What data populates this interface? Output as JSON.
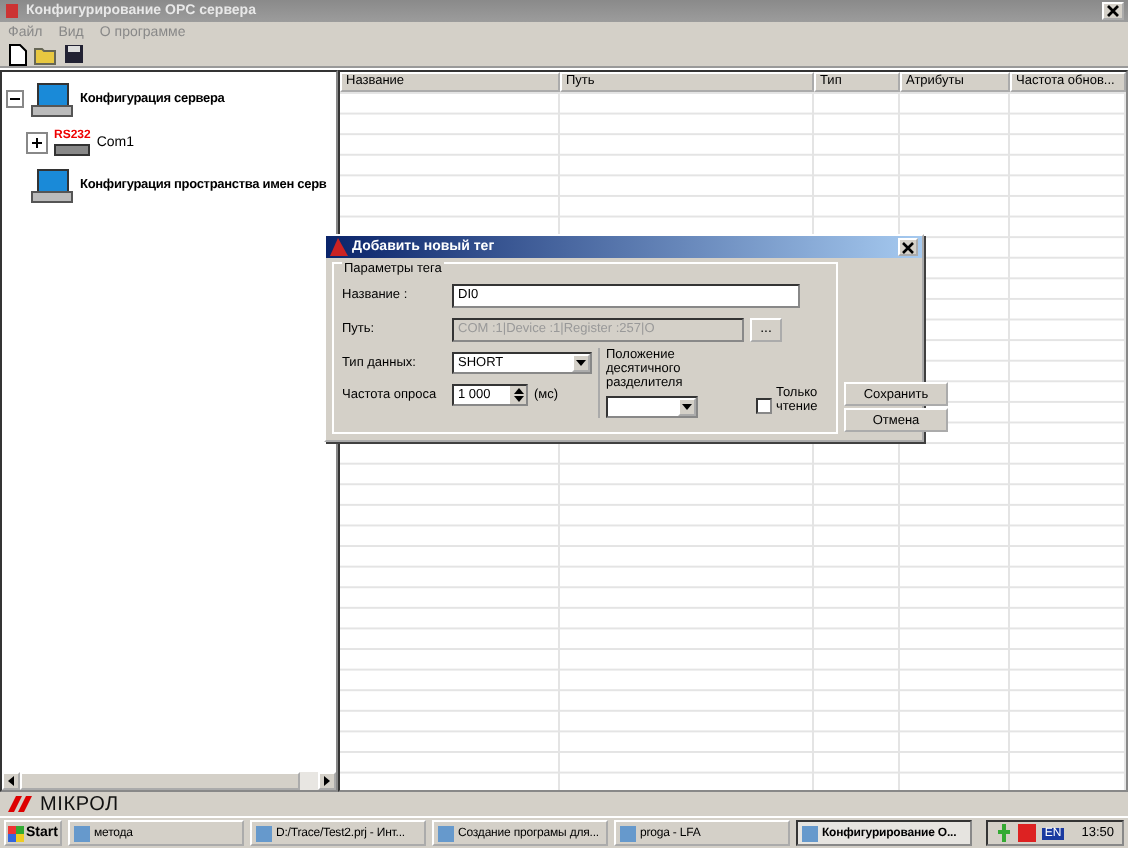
{
  "window": {
    "title": "Конфигурирование OPC сервера"
  },
  "menu": [
    {
      "label": "Файл"
    },
    {
      "label": "Вид"
    },
    {
      "label": "О программе"
    }
  ],
  "tree": [
    {
      "label": "Конфигурация сервера",
      "expanded": true,
      "children": [
        {
          "badge": "RS232",
          "label": "Com1",
          "expanded": false
        }
      ]
    },
    {
      "label": "Конфигурация пространства имен серв"
    }
  ],
  "table": {
    "columns": [
      "Название",
      "Путь",
      "Тип",
      "Атрибуты",
      "Частота обнов..."
    ]
  },
  "dialog": {
    "title": "Добавить новый тег",
    "group_label": "Параметры тега",
    "name": {
      "label": "Название :",
      "value": "DI0"
    },
    "path": {
      "label": "Путь:",
      "value": "COM :1|Device :1|Register :257|O",
      "disabled": true,
      "browse": "..."
    },
    "type": {
      "label": "Тип данных:",
      "value": "SHORT"
    },
    "frequency": {
      "label": "Частота опроса",
      "value": "1 000",
      "unit": "(мс)"
    },
    "decimal": {
      "label": "Положение десятичного разделителя"
    },
    "readonly": {
      "label": "Только чтение",
      "checked": false
    },
    "buttons": [
      "Сохранить",
      "Отмена"
    ]
  },
  "logo": "МІКРОЛ",
  "taskbar": {
    "start": "Start",
    "items": [
      {
        "label": "метода",
        "selected": false
      },
      {
        "label": "D:/Trace/Test2.prj - Инт...",
        "selected": false
      },
      {
        "label": "Создание програмы для...",
        "selected": false
      },
      {
        "label": "proga - LFA",
        "selected": false
      },
      {
        "label": "Конфигурирование О...",
        "selected": true
      }
    ],
    "lang": "EN",
    "clock": "13:50"
  }
}
